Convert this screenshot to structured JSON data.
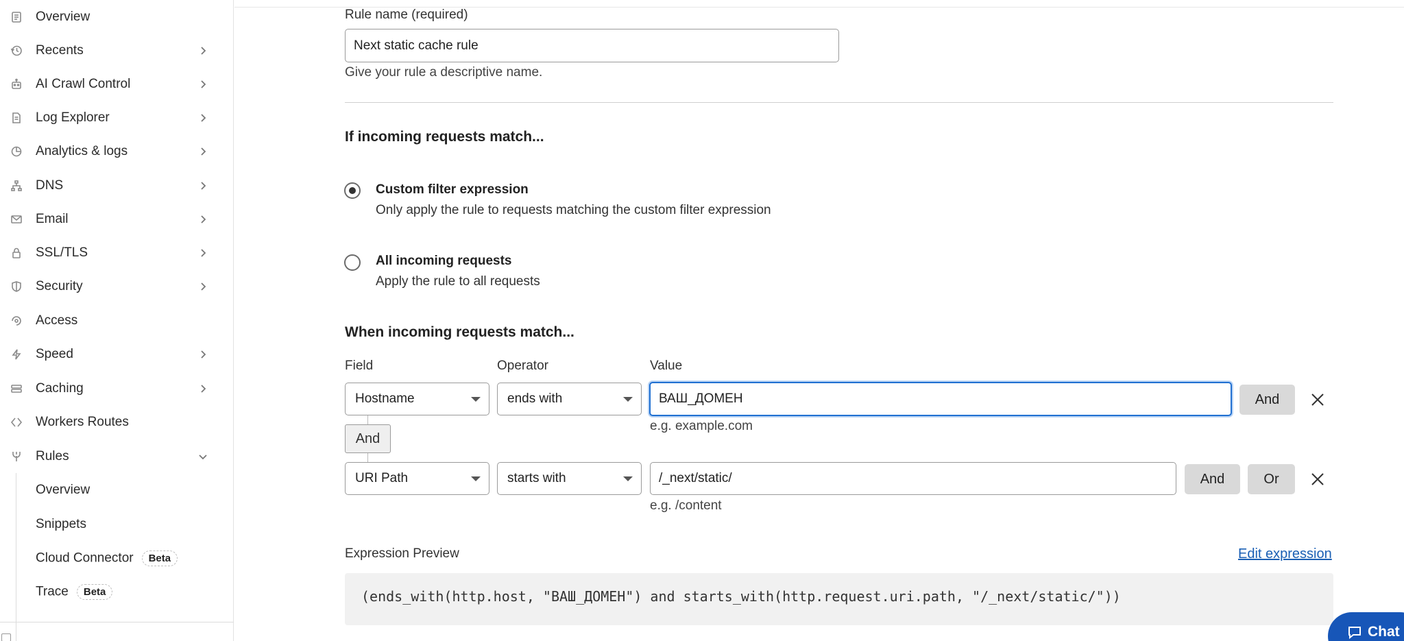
{
  "sidebar": {
    "items": [
      {
        "label": "Overview",
        "icon": "document-icon",
        "chevron": false
      },
      {
        "label": "Recents",
        "icon": "history-icon",
        "chevron": true
      },
      {
        "label": "AI Crawl Control",
        "icon": "robot-icon",
        "chevron": true
      },
      {
        "label": "Log Explorer",
        "icon": "log-file-icon",
        "chevron": true
      },
      {
        "label": "Analytics & logs",
        "icon": "pie-chart-icon",
        "chevron": true
      },
      {
        "label": "DNS",
        "icon": "network-tree-icon",
        "chevron": true
      },
      {
        "label": "Email",
        "icon": "envelope-icon",
        "chevron": true
      },
      {
        "label": "SSL/TLS",
        "icon": "lock-icon",
        "chevron": true
      },
      {
        "label": "Security",
        "icon": "shield-icon",
        "chevron": true
      },
      {
        "label": "Access",
        "icon": "access-loop-icon",
        "chevron": false
      },
      {
        "label": "Speed",
        "icon": "lightning-icon",
        "chevron": true
      },
      {
        "label": "Caching",
        "icon": "server-stack-icon",
        "chevron": true
      },
      {
        "label": "Workers Routes",
        "icon": "workers-diamond-icon",
        "chevron": false
      },
      {
        "label": "Rules",
        "icon": "rules-fork-icon",
        "chevron": "down"
      }
    ],
    "sub_items": [
      {
        "label": "Overview"
      },
      {
        "label": "Snippets"
      },
      {
        "label": "Cloud Connector",
        "badge": "Beta"
      },
      {
        "label": "Trace",
        "badge": "Beta"
      }
    ]
  },
  "form": {
    "rule_name_label": "Rule name (required)",
    "rule_name_value": "Next static cache rule",
    "rule_name_hint": "Give your rule a descriptive name.",
    "if_heading": "If incoming requests match...",
    "option_custom_title": "Custom filter expression",
    "option_custom_desc": "Only apply the rule to requests matching the custom filter expression",
    "option_all_title": "All incoming requests",
    "option_all_desc": "Apply the rule to all requests",
    "when_heading": "When incoming requests match...",
    "col_field": "Field",
    "col_operator": "Operator",
    "col_value": "Value",
    "row1": {
      "field": "Hostname",
      "operator": "ends with",
      "value": "ВАШ_ДОМЕН",
      "hint": "e.g. example.com",
      "and_label": "And"
    },
    "connector_label": "And",
    "row2": {
      "field": "URI Path",
      "operator": "starts with",
      "value": "/_next/static/",
      "hint": "e.g. /content",
      "and_label": "And",
      "or_label": "Or"
    },
    "preview_label": "Expression Preview",
    "edit_expression": "Edit expression",
    "expression": "(ends_with(http.host, \"ВАШ_ДОМЕН\") and starts_with(http.request.uri.path, \"/_next/static/\"))"
  },
  "chat": {
    "label": "Chat"
  },
  "colors": {
    "accent": "#1f6fd1",
    "link": "#1a5fb4",
    "chat": "#1756b8"
  }
}
